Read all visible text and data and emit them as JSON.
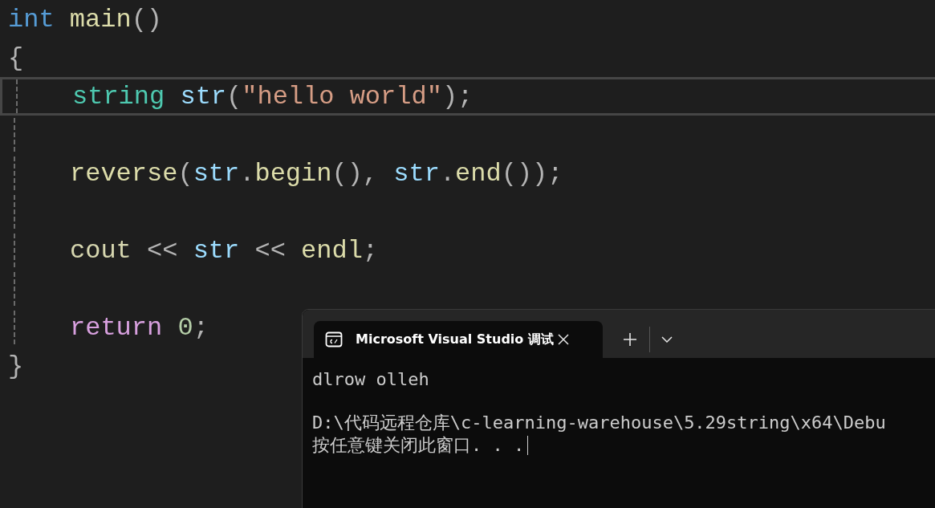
{
  "editor": {
    "lines": [
      {
        "indented": false,
        "current": false,
        "tokens": [
          {
            "text": "int ",
            "kind": "keyword"
          },
          {
            "text": "main",
            "kind": "function"
          },
          {
            "text": "()",
            "kind": "punct"
          }
        ]
      },
      {
        "indented": false,
        "current": false,
        "tokens": [
          {
            "text": "{",
            "kind": "punct"
          }
        ]
      },
      {
        "indented": true,
        "current": true,
        "tokens": [
          {
            "text": "string ",
            "kind": "type"
          },
          {
            "text": "str",
            "kind": "variable"
          },
          {
            "text": "(",
            "kind": "punct"
          },
          {
            "text": "\"hello world\"",
            "kind": "string"
          },
          {
            "text": ");",
            "kind": "punct"
          }
        ]
      },
      {
        "indented": true,
        "current": false
      },
      {
        "indented": true,
        "current": false,
        "tokens": [
          {
            "text": "reverse",
            "kind": "function"
          },
          {
            "text": "(",
            "kind": "punct"
          },
          {
            "text": "str",
            "kind": "variable"
          },
          {
            "text": ".",
            "kind": "punct"
          },
          {
            "text": "begin",
            "kind": "function"
          },
          {
            "text": "(), ",
            "kind": "punct"
          },
          {
            "text": "str",
            "kind": "variable"
          },
          {
            "text": ".",
            "kind": "punct"
          },
          {
            "text": "end",
            "kind": "function"
          },
          {
            "text": "());",
            "kind": "punct"
          }
        ]
      },
      {
        "indented": true,
        "current": false
      },
      {
        "indented": true,
        "current": false,
        "tokens": [
          {
            "text": "cout",
            "kind": "stream"
          },
          {
            "text": " << ",
            "kind": "punct"
          },
          {
            "text": "str",
            "kind": "variable"
          },
          {
            "text": " << ",
            "kind": "punct"
          },
          {
            "text": "endl",
            "kind": "function"
          },
          {
            "text": ";",
            "kind": "punct"
          }
        ]
      },
      {
        "indented": true,
        "current": false
      },
      {
        "indented": true,
        "current": false,
        "tokens": [
          {
            "text": "return ",
            "kind": "control"
          },
          {
            "text": "0",
            "kind": "number"
          },
          {
            "text": ";",
            "kind": "punct"
          }
        ]
      },
      {
        "indented": false,
        "current": false,
        "tokens": [
          {
            "text": "}",
            "kind": "punct"
          }
        ]
      }
    ]
  },
  "terminal": {
    "tabs": [
      {
        "title": "Microsoft Visual Studio 调试",
        "selected": true
      }
    ],
    "output": [
      {
        "lines": [
          "dlrow olleh"
        ]
      },
      {
        "lines": [
          "D:\\代码远程仓库\\c-learning-warehouse\\5.29string\\x64\\Debu",
          "按任意键关闭此窗口. . ."
        ]
      }
    ]
  }
}
